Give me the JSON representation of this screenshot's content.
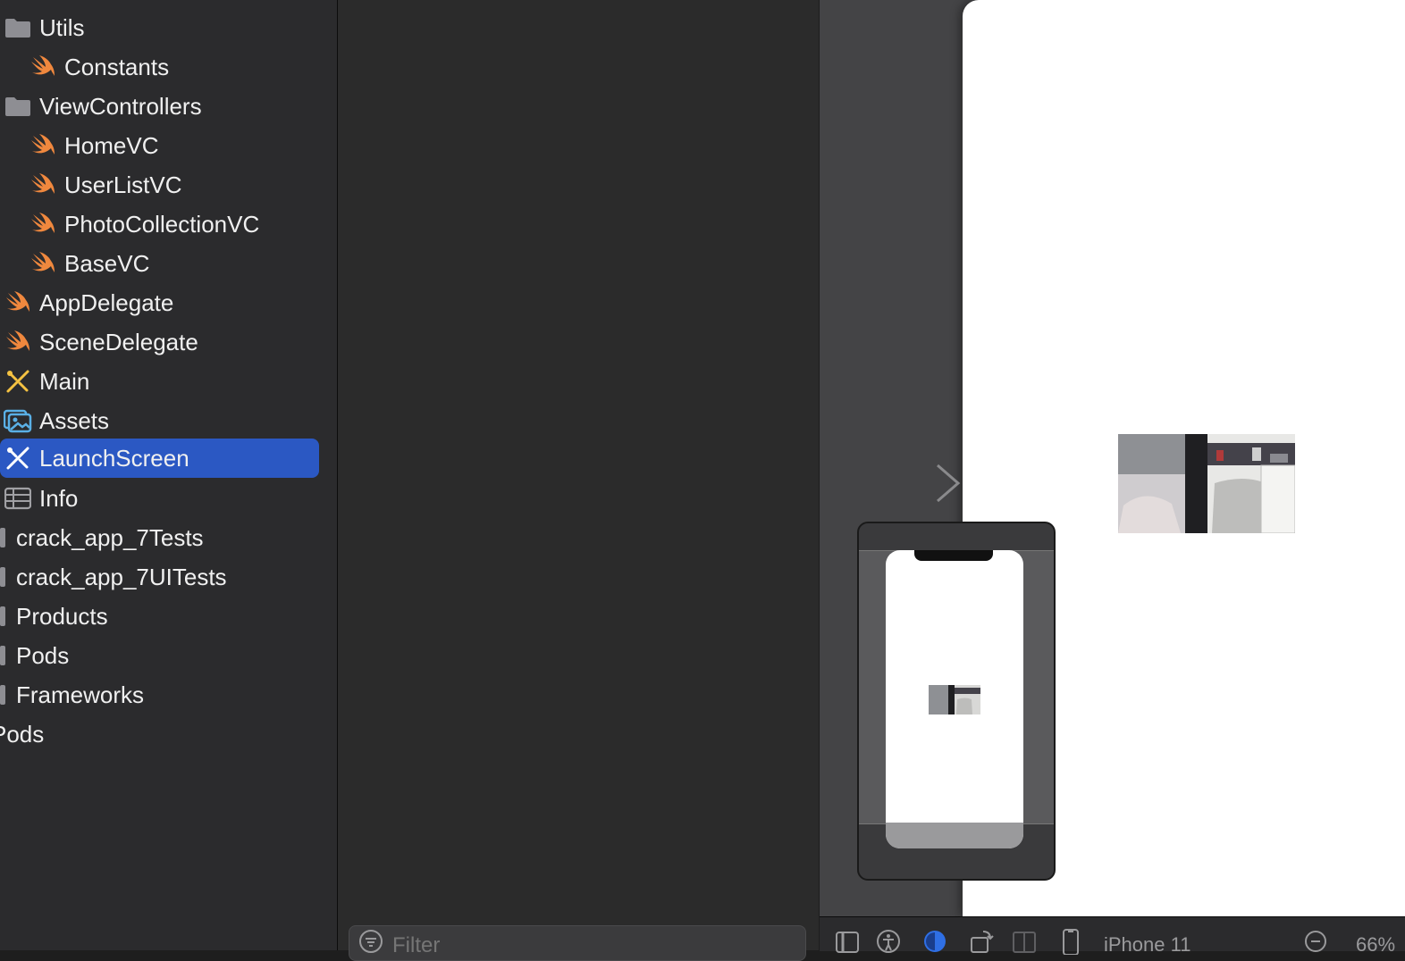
{
  "navigator": {
    "items": [
      {
        "label": "Utils",
        "icon": "folder-icon"
      },
      {
        "label": "Constants",
        "icon": "swift-file-icon"
      },
      {
        "label": "ViewControllers",
        "icon": "folder-icon"
      },
      {
        "label": "HomeVC",
        "icon": "swift-file-icon"
      },
      {
        "label": "UserListVC",
        "icon": "swift-file-icon"
      },
      {
        "label": "PhotoCollectionVC",
        "icon": "swift-file-icon"
      },
      {
        "label": "BaseVC",
        "icon": "swift-file-icon"
      },
      {
        "label": "AppDelegate",
        "icon": "swift-file-icon"
      },
      {
        "label": "SceneDelegate",
        "icon": "swift-file-icon"
      },
      {
        "label": "Main",
        "icon": "storyboard-icon"
      },
      {
        "label": "Assets",
        "icon": "asset-catalog-icon"
      },
      {
        "label": "LaunchScreen",
        "icon": "storyboard-icon",
        "selected": true
      },
      {
        "label": "Info",
        "icon": "plist-icon"
      },
      {
        "label": "crack_app_7Tests",
        "icon": "group-icon"
      },
      {
        "label": "crack_app_7UITests",
        "icon": "group-icon"
      },
      {
        "label": "Products",
        "icon": "group-icon"
      },
      {
        "label": "Pods",
        "icon": "group-icon"
      },
      {
        "label": "Frameworks",
        "icon": "group-icon"
      },
      {
        "label": "Pods",
        "icon": "project-icon"
      }
    ]
  },
  "outline": {
    "filter_placeholder": "Filter"
  },
  "canvas_toolbar": {
    "device": "iPhone 11",
    "zoom": "66%"
  },
  "colors": {
    "selection": "#2b58c3",
    "swift": "#f0883e",
    "storyboard": "#f5c242",
    "assets": "#5ab0e6",
    "accent": "#2f6fe4"
  }
}
